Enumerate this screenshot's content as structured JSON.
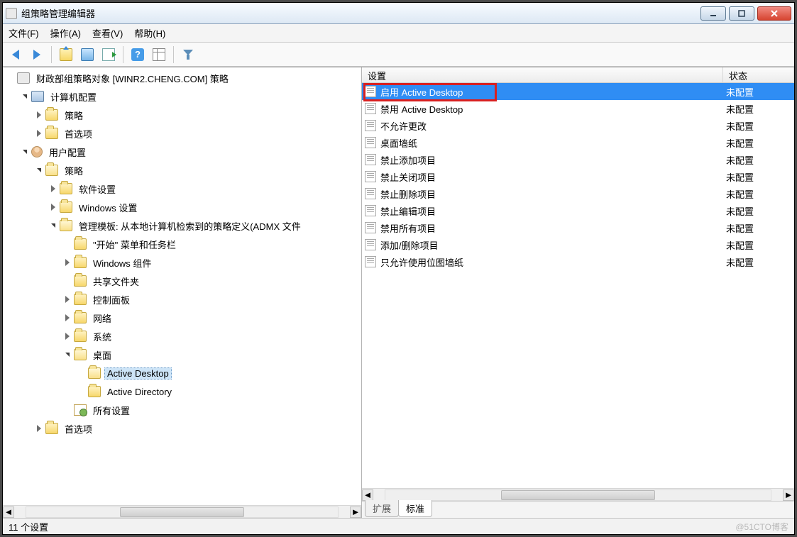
{
  "window": {
    "title": "组策略管理编辑器"
  },
  "menus": {
    "file": "文件(F)",
    "action": "操作(A)",
    "view": "查看(V)",
    "help": "帮助(H)"
  },
  "tree": {
    "root": "财政部组策略对象 [WINR2.CHENG.COM] 策略",
    "computer": "计算机配置",
    "comp_policy": "策略",
    "comp_pref": "首选项",
    "user": "用户配置",
    "user_policy": "策略",
    "soft": "软件设置",
    "windows_settings": "Windows 设置",
    "admin_templates": "管理模板: 从本地计算机检索到的策略定义(ADMX 文件",
    "start_menu": "\"开始\" 菜单和任务栏",
    "windows_comp": "Windows 组件",
    "shared": "共享文件夹",
    "control_panel": "控制面板",
    "network": "网络",
    "system": "系统",
    "desktop": "桌面",
    "active_desktop": "Active Desktop",
    "active_directory": "Active Directory",
    "all_settings": "所有设置",
    "user_pref": "首选项"
  },
  "columns": {
    "setting": "设置",
    "state": "状态"
  },
  "settings": [
    {
      "name": "启用 Active Desktop",
      "state": "未配置",
      "selected": true
    },
    {
      "name": "禁用 Active Desktop",
      "state": "未配置"
    },
    {
      "name": "不允许更改",
      "state": "未配置"
    },
    {
      "name": "桌面墙纸",
      "state": "未配置"
    },
    {
      "name": "禁止添加项目",
      "state": "未配置"
    },
    {
      "name": "禁止关闭项目",
      "state": "未配置"
    },
    {
      "name": "禁止删除项目",
      "state": "未配置"
    },
    {
      "name": "禁止编辑项目",
      "state": "未配置"
    },
    {
      "name": "禁用所有项目",
      "state": "未配置"
    },
    {
      "name": "添加/删除项目",
      "state": "未配置"
    },
    {
      "name": "只允许使用位图墙纸",
      "state": "未配置"
    }
  ],
  "tabs": {
    "extended": "扩展",
    "standard": "标准"
  },
  "status": "11 个设置",
  "watermark": "@51CTO博客"
}
